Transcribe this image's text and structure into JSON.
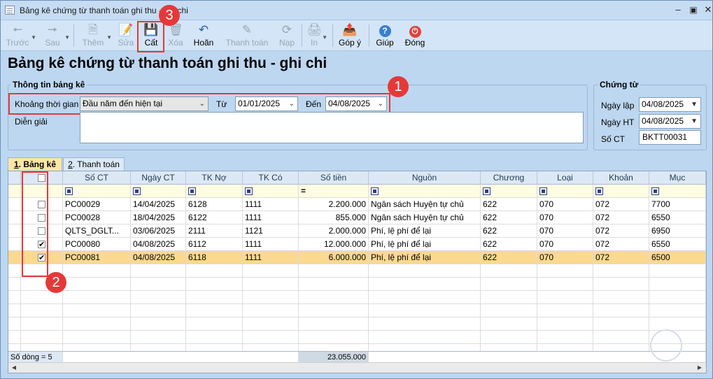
{
  "window": {
    "title": "Bảng kê chứng từ thanh toán ghi thu - ghi chi"
  },
  "toolbar": {
    "back": "Trước",
    "next": "Sau",
    "add": "Thêm",
    "edit": "Sửa",
    "save": "Cất",
    "delete": "Xóa",
    "undo": "Hoãn",
    "pay": "Thanh toán",
    "reload": "Nạp",
    "print": "In",
    "feedback": "Góp ý",
    "help": "Giúp",
    "close": "Đóng"
  },
  "page_title": "Bảng kê chứng từ thanh toán ghi thu - ghi chi",
  "info": {
    "legend": "Thông tin bảng kê",
    "period_label": "Khoảng thời gian",
    "period_value": "Đầu năm đến hiện tại",
    "from_label": "Từ",
    "from_value": "01/01/2025",
    "to_label": "Đến",
    "to_value": "04/08/2025",
    "note_label": "Diễn giải",
    "note_value": ""
  },
  "voucher": {
    "legend": "Chứng từ",
    "date_label": "Ngày lập",
    "date_value": "04/08/2025",
    "ht_label": "Ngày HT",
    "ht_value": "04/08/2025",
    "no_label": "Số CT",
    "no_value": "BKTT00031"
  },
  "tabs": [
    {
      "key": "1",
      "label": ". Bảng kê"
    },
    {
      "key": "2",
      "label": ". Thanh toán"
    }
  ],
  "grid": {
    "columns": [
      "Số CT",
      "Ngày CT",
      "TK Nợ",
      "TK Có",
      "Số tiền",
      "Nguồn",
      "Chương",
      "Loại",
      "Khoản",
      "Mục"
    ],
    "amount_filter_op": "=",
    "rows": [
      {
        "checked": false,
        "so_ct": "PC00029",
        "ngay_ct": "14/04/2025",
        "tk_no": "6128",
        "tk_co": "1111",
        "so_tien": "2.200.000",
        "nguon": "Ngân sách Huyện tự chủ",
        "chuong": "622",
        "loai": "070",
        "khoan": "072",
        "muc": "7700"
      },
      {
        "checked": false,
        "so_ct": "PC00028",
        "ngay_ct": "18/04/2025",
        "tk_no": "6122",
        "tk_co": "1111",
        "so_tien": "855.000",
        "nguon": "Ngân sách Huyện tự chủ",
        "chuong": "622",
        "loai": "070",
        "khoan": "072",
        "muc": "6550"
      },
      {
        "checked": false,
        "so_ct": "QLTS_DGLT...",
        "ngay_ct": "03/06/2025",
        "tk_no": "2111",
        "tk_co": "1121",
        "so_tien": "2.000.000",
        "nguon": "Phí, lệ phí để lại",
        "chuong": "622",
        "loai": "070",
        "khoan": "072",
        "muc": "6950"
      },
      {
        "checked": true,
        "so_ct": "PC00080",
        "ngay_ct": "04/08/2025",
        "tk_no": "6112",
        "tk_co": "1111",
        "so_tien": "12.000.000",
        "nguon": "Phí, lệ phí để lại",
        "chuong": "622",
        "loai": "070",
        "khoan": "072",
        "muc": "6550"
      },
      {
        "checked": true,
        "so_ct": "PC00081",
        "ngay_ct": "04/08/2025",
        "tk_no": "6118",
        "tk_co": "1111",
        "so_tien": "6.000.000",
        "nguon": "Phí, lệ phí để lại",
        "chuong": "622",
        "loai": "070",
        "khoan": "072",
        "muc": "6500"
      }
    ],
    "footer_count": "Số dòng = 5",
    "footer_total": "23.055.000"
  },
  "annotations": [
    "1",
    "2",
    "3"
  ],
  "colors": {
    "accent_red": "#e53939",
    "selected_row": "#fbd98e",
    "window_bg": "#bdd7f1"
  }
}
